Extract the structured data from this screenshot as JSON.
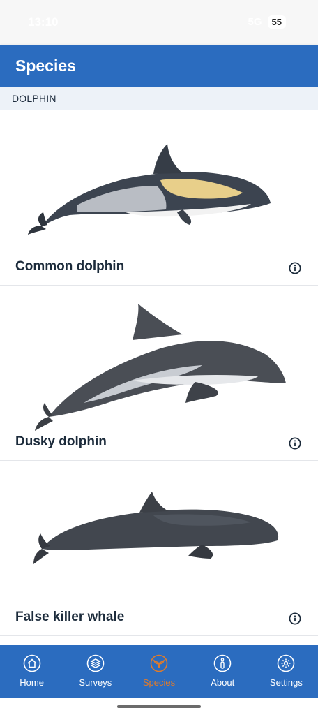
{
  "status_bar": {
    "time": "13:10",
    "network": "5G",
    "battery": "55"
  },
  "app_bar": {
    "title": "Species"
  },
  "section": {
    "label": "DOLPHIN"
  },
  "species": [
    {
      "name": "Common dolphin",
      "image_icon": "common-dolphin-illustration",
      "info_icon": "info-icon"
    },
    {
      "name": "Dusky dolphin",
      "image_icon": "dusky-dolphin-illustration",
      "info_icon": "info-icon"
    },
    {
      "name": "False killer whale",
      "image_icon": "false-killer-whale-illustration",
      "info_icon": "info-icon"
    }
  ],
  "bottom_nav": {
    "items": [
      {
        "label": "Home",
        "icon": "home-icon",
        "active": false
      },
      {
        "label": "Surveys",
        "icon": "layers-icon",
        "active": false
      },
      {
        "label": "Species",
        "icon": "whale-tail-icon",
        "active": true
      },
      {
        "label": "About",
        "icon": "info-icon",
        "active": false
      },
      {
        "label": "Settings",
        "icon": "gear-icon",
        "active": false
      }
    ],
    "active_color": "#e07b2a",
    "background_color": "#2b6cbf"
  },
  "colors": {
    "primary": "#2b6cbf",
    "section_background": "#edf2f8"
  }
}
